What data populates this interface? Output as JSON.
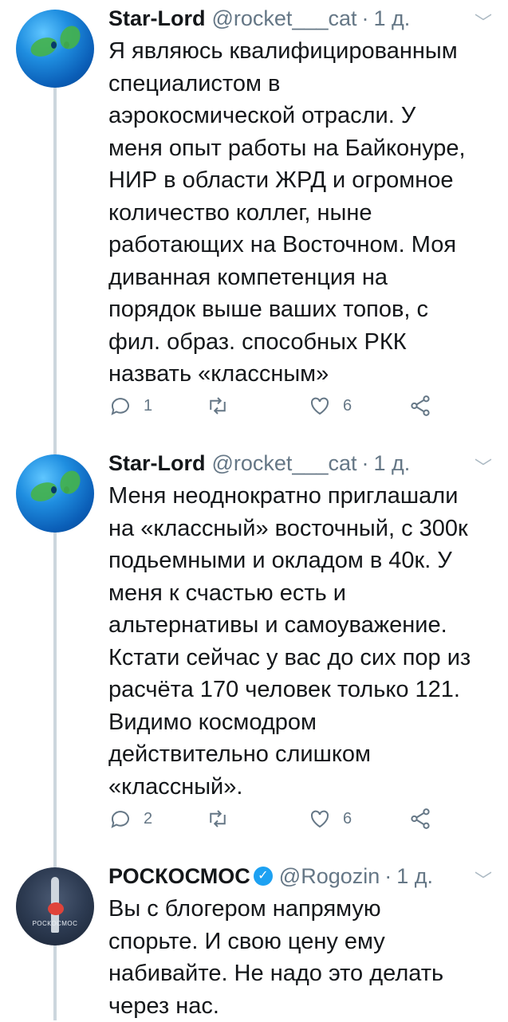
{
  "tweets": [
    {
      "name": "Star-Lord",
      "handle": "@rocket___cat",
      "separator": "·",
      "time": "1 д.",
      "text": "Я являюсь квалифицированным\nспециалистом в\nаэрокосмической отрасли. У\nменя опыт работы на Байконуре,\nНИР в области ЖРД и огромное\nколичество коллег, ныне\nработающих на Восточном. Моя\nдиванная компетенция на\nпорядок выше ваших топов, с\nфил. образ. способных РКК\nназвать «классным»",
      "replies": "1",
      "retweets": "",
      "likes": "6"
    },
    {
      "name": "Star-Lord",
      "handle": "@rocket___cat",
      "separator": "·",
      "time": "1 д.",
      "text": "Меня неоднократно приглашали\nна «классный» восточный, с 300к\nподьемными и окладом в 40к. У\nменя к счастью есть и\nальтернативы и самоуважение.\nКстати сейчас у вас до сих пор из\nрасчёта 170 человек только 121.\nВидимо космодром\nдействительно слишком\n«классный».",
      "replies": "2",
      "retweets": "",
      "likes": "6"
    },
    {
      "name": "РОСКОСМОС",
      "verified": true,
      "handle": "@Rogozin",
      "separator": "·",
      "time": "1 д.",
      "text": "Вы с блогером напрямую\nспорьте. И свою цену ему\nнабивайте. Не надо это делать\nчерез нас.",
      "avatar_text": "РОСКОСМОС"
    }
  ],
  "icons": {
    "reply": "reply-icon",
    "retweet": "retweet-icon",
    "like": "heart-icon",
    "share": "share-icon",
    "menu": "chevron-down-icon",
    "verified": "verified-badge-icon"
  },
  "colors": {
    "text": "#14171a",
    "secondary": "#657786",
    "thread_line": "#ccd6dd",
    "verified": "#1da1f2"
  }
}
